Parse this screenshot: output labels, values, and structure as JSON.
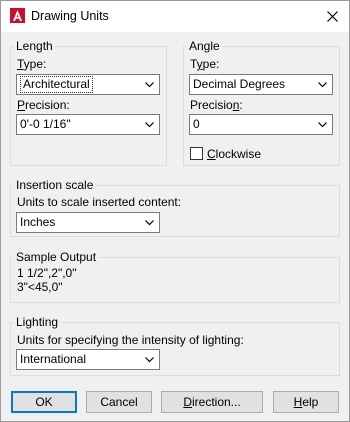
{
  "window": {
    "title": "Drawing Units"
  },
  "length": {
    "group_title": "Length",
    "type_label_u": "T",
    "type_label_rest": "ype:",
    "type_value": "Architectural",
    "precision_label_u": "P",
    "precision_label_rest": "recision:",
    "precision_value": "0'-0 1/16\""
  },
  "angle": {
    "group_title": "Angle",
    "type_label_pre": "T",
    "type_label_u": "y",
    "type_label_rest": "pe:",
    "type_value": "Decimal Degrees",
    "precision_label_pre": "Precisio",
    "precision_label_u": "n",
    "precision_label_rest": ":",
    "precision_value": "0",
    "clockwise_label_u": "C",
    "clockwise_label_rest": "lockwise",
    "clockwise_checked": false
  },
  "insertion": {
    "group_title": "Insertion scale",
    "label": "Units to scale inserted content:",
    "value": "Inches"
  },
  "sample": {
    "group_title": "Sample Output",
    "line1": "1 1/2\",2\",0\"",
    "line2": "3\"<45,0\""
  },
  "lighting": {
    "group_title": "Lighting",
    "label": "Units for specifying the intensity of lighting:",
    "value": "International"
  },
  "buttons": {
    "ok": "OK",
    "cancel": "Cancel",
    "direction_u": "D",
    "direction_rest": "irection...",
    "help_u": "H",
    "help_rest": "elp"
  },
  "colors": {
    "accent": "#0078d7",
    "autocad_red": "#c8102e"
  }
}
